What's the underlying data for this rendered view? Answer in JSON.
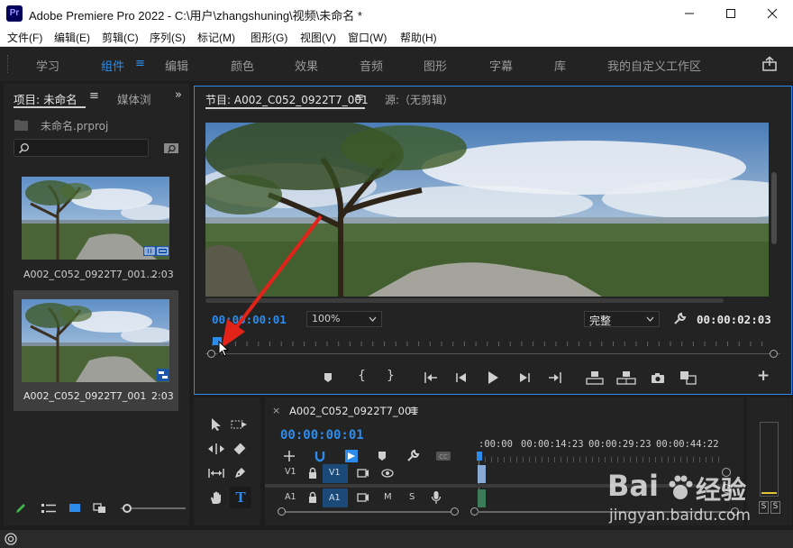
{
  "window": {
    "app_icon": "Pr",
    "title": "Adobe Premiere Pro 2022 - C:\\用户\\zhangshuning\\视频\\未命名 *"
  },
  "menu": [
    "文件(F)",
    "编辑(E)",
    "剪辑(C)",
    "序列(S)",
    "标记(M)",
    "图形(G)",
    "视图(V)",
    "窗口(W)",
    "帮助(H)"
  ],
  "workspaces": [
    "学习",
    "组件",
    "编辑",
    "颜色",
    "效果",
    "音频",
    "图形",
    "字幕",
    "库",
    "我的自定义工作区"
  ],
  "active_workspace": "组件",
  "project": {
    "tab_label": "项目: 未命名",
    "tab2_label": "媒体浏",
    "file_name": "未命名.prproj",
    "search_placeholder": "",
    "items": [
      {
        "name": "A002_C052_0922T7_001...",
        "duration": "2:03"
      },
      {
        "name": "A002_C052_0922T7_001",
        "duration": "2:03"
      }
    ]
  },
  "program": {
    "tab_label": "节目: A002_C052_0922T7_001",
    "source_label": "源:（无剪辑）",
    "timecode_in": "00:00:00:01",
    "zoom": "100%",
    "quality": "完整",
    "timecode_out": "00:00:02:03"
  },
  "timeline": {
    "tab_label": "A002_C052_0922T7_001",
    "timecode": "00:00:00:01",
    "ruler": [
      ":00:00",
      "00:00:14:23",
      "00:00:29:23",
      "00:00:44:22"
    ],
    "tracks": [
      {
        "label": "V1",
        "target": "V1"
      },
      {
        "label": "A1",
        "target": "A1",
        "mute": "M",
        "solo": "S"
      }
    ]
  },
  "meter": {
    "solo_left": "S",
    "solo_right": "S"
  },
  "watermark": {
    "brand": "Bai",
    "brand2": "经验",
    "url": "jingyan.baidu.com"
  }
}
